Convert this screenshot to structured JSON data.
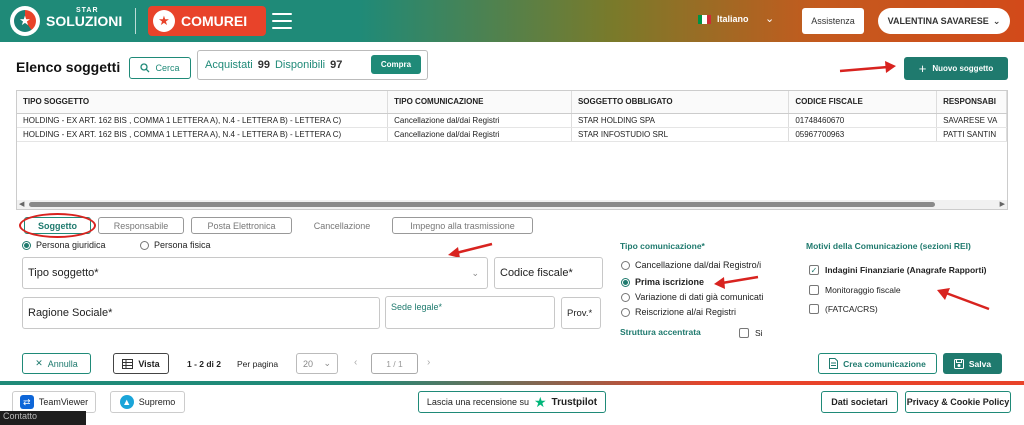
{
  "header": {
    "logo_small": "STAR",
    "logo_big": "SOLUZIONI",
    "app_name": "COMUREI",
    "language": "Italiano",
    "assist_label": "Assistenza",
    "user_name": "VALENTINA SAVARESE"
  },
  "toolbar": {
    "title": "Elenco soggetti",
    "search_label": "Cerca",
    "acquired_label": "Acquistati",
    "acquired_count": "99",
    "available_label": "Disponibili",
    "available_count": "97",
    "buy_label": "Compra",
    "new_label": "Nuovo soggetto"
  },
  "table": {
    "columns": [
      "TIPO SOGGETTO",
      "TIPO COMUNICAZIONE",
      "SOGGETTO OBBLIGATO",
      "CODICE FISCALE",
      "RESPONSABI"
    ],
    "rows": [
      [
        "HOLDING - EX ART. 162 BIS , COMMA 1 LETTERA A), N.4 - LETTERA B) - LETTERA C)",
        "Cancellazione dal/dai Registri",
        "STAR HOLDING SPA",
        "01748460670",
        "SAVARESE VA"
      ],
      [
        "HOLDING - EX ART. 162 BIS , COMMA 1 LETTERA A), N.4 - LETTERA B) - LETTERA C)",
        "Cancellazione dal/dai Registri",
        "STAR INFOSTUDIO SRL",
        "05967700963",
        "PATTI SANTIN"
      ]
    ]
  },
  "tabs": [
    {
      "label": "Soggetto",
      "active": true
    },
    {
      "label": "Responsabile",
      "active": false
    },
    {
      "label": "Posta Elettronica",
      "active": false
    },
    {
      "label": "Cancellazione",
      "active": false
    },
    {
      "label": "Impegno alla trasmissione",
      "active": false
    }
  ],
  "form": {
    "persona_giuridica": "Persona giuridica",
    "persona_fisica": "Persona fisica",
    "tipo_soggetto": "Tipo soggetto*",
    "codice_fiscale": "Codice fiscale*",
    "ragione_sociale": "Ragione Sociale*",
    "sede_legale": "Sede legale*",
    "prov": "Prov.*"
  },
  "tipo_comunicazione": {
    "title": "Tipo comunicazione*",
    "options": [
      {
        "label": "Cancellazione dal/dai Registro/i",
        "selected": false
      },
      {
        "label": "Prima iscrizione",
        "selected": true
      },
      {
        "label": "Variazione di dati già comunicati",
        "selected": false
      },
      {
        "label": "Reiscrizione al/ai Registri",
        "selected": false
      }
    ],
    "struttura_label": "Struttura accentrata",
    "struttura_si": "Si"
  },
  "motivi": {
    "title": "Motivi della Comunicazione (sezioni REI)",
    "options": [
      {
        "label": "Indagini Finanziarie (Anagrafe Rapporti)",
        "checked": true
      },
      {
        "label": "Monitoraggio fiscale",
        "checked": false
      },
      {
        "label": "(FATCA/CRS)",
        "checked": false
      }
    ]
  },
  "actions": {
    "annulla": "Annulla",
    "vista": "Vista",
    "pag_info": "1 - 2 di 2",
    "per_pagina": "Per pagina",
    "per_pagina_value": "20",
    "page_value": "1 / 1",
    "crea": "Crea comunicazione",
    "salva": "Salva"
  },
  "footer": {
    "teamviewer": "TeamViewer",
    "supremo": "Supremo",
    "review_prefix": "Lascia una recensione su",
    "trustpilot": "Trustpilot",
    "dati_societari": "Dati societari",
    "privacy": "Privacy & Cookie Policy",
    "contatto": "Contatto"
  },
  "colors": {
    "primary": "#1f7a6e",
    "accent": "#e8432a",
    "annotation": "#d8231f"
  }
}
